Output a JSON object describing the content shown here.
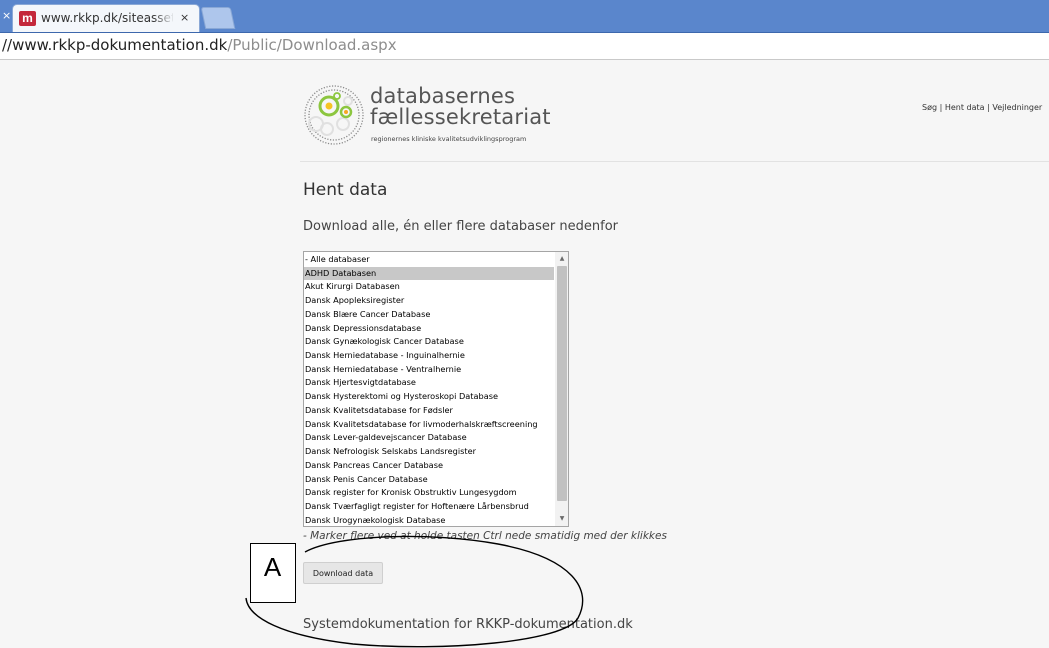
{
  "browser": {
    "tab": {
      "favicon_letter": "m",
      "title": "www.rkkp.dk/siteassets",
      "close_glyph": "×"
    },
    "left_close_glyph": "×",
    "url": {
      "prefix": "//",
      "host": "www.rkkp-dokumentation.dk",
      "path": "/Public/Download.aspx"
    },
    "accent_color": "#5a86cc"
  },
  "logo": {
    "line1": "databasernes",
    "line2": "fællessekretariat",
    "tagline": "regionernes kliniske kvalitetsudviklingsprogram",
    "icon": "molecule-logo-icon",
    "colors": [
      "#8cc63f",
      "#e3e3e3",
      "#f6a623"
    ]
  },
  "topnav": {
    "items": [
      "Søg",
      "Hent data",
      "Vejledninger"
    ],
    "separator": " | "
  },
  "page": {
    "heading": "Hent data",
    "subheading": "Download alle, én eller flere databaser nedenfor",
    "hint": "- Marker flere ved at holde tasten Ctrl nede smatidig med der klikkes",
    "download_button": "Download data",
    "footer_link": "Systemdokumentation for RKKP-dokumentation.dk"
  },
  "database_list": {
    "selected_index": 1,
    "items": [
      "- Alle databaser",
      "ADHD Databasen",
      "Akut Kirurgi Databasen",
      "Dansk Apopleksiregister",
      "Dansk Blære Cancer Database",
      "Dansk Depressionsdatabase",
      "Dansk Gynækologisk Cancer Database",
      "Dansk Herniedatabase - Inguinalhernie",
      "Dansk Herniedatabase - Ventralhernie",
      "Dansk Hjertesvigtdatabase",
      "Dansk Hysterektomi og Hysteroskopi Database",
      "Dansk Kvalitetsdatabase for Fødsler",
      "Dansk Kvalitetsdatabase for livmoderhalskræftscreening",
      "Dansk Lever-galdevejscancer Database",
      "Dansk Nefrologisk Selskabs Landsregister",
      "Dansk Pancreas Cancer Database",
      "Dansk Penis Cancer Database",
      "Dansk register for Kronisk Obstruktiv Lungesygdom",
      "Dansk Tværfagligt register for Hoftenære Lårbensbrud",
      "Dansk Urogynækologisk Database"
    ]
  },
  "annotation": {
    "label": "A"
  }
}
